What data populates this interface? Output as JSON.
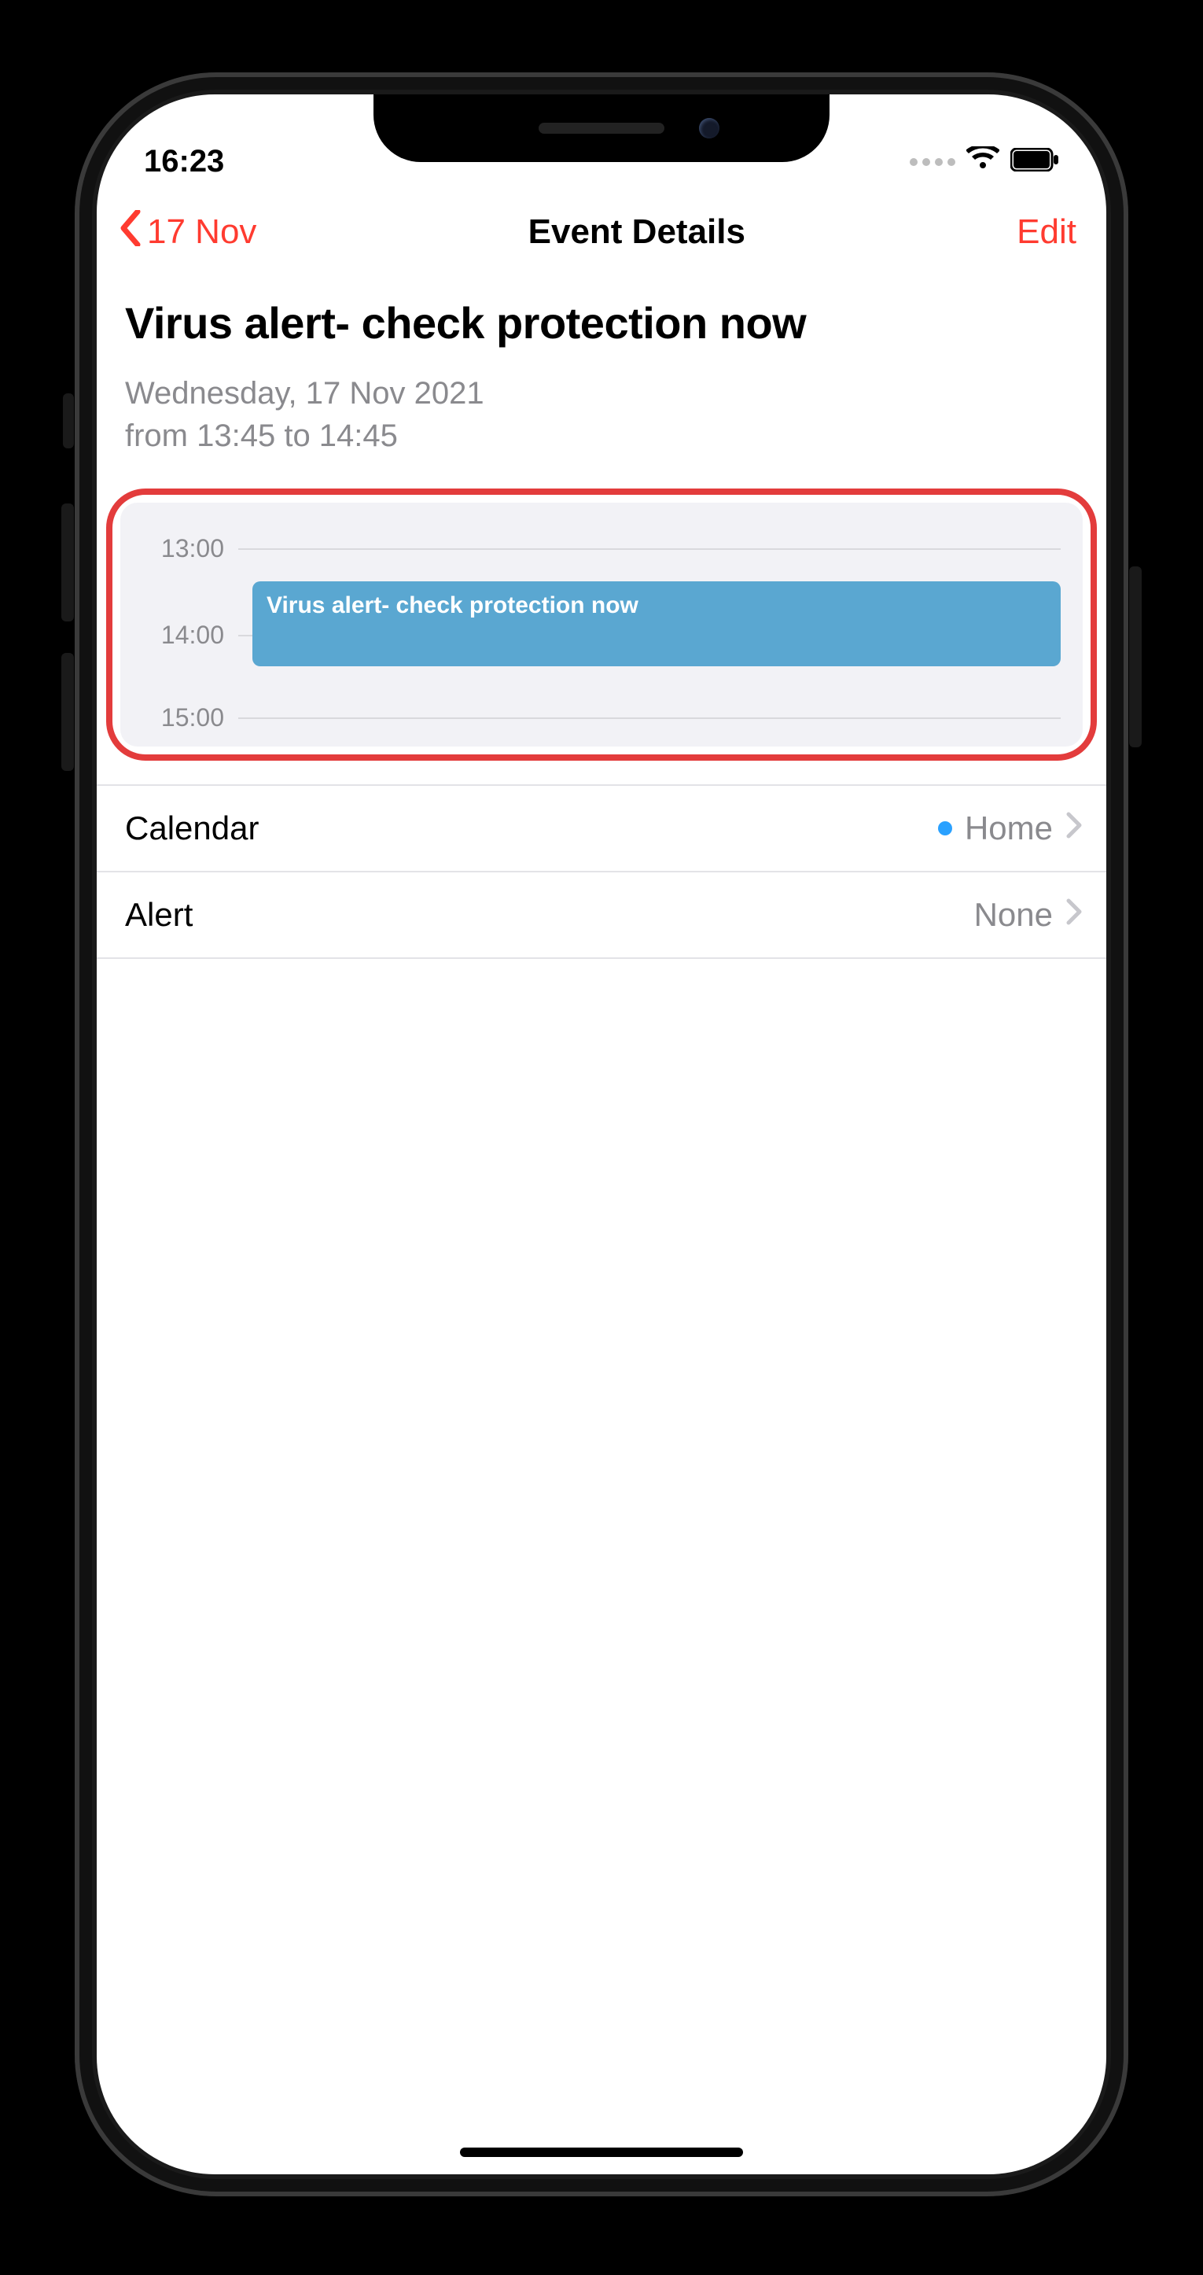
{
  "statusbar": {
    "time": "16:23"
  },
  "nav": {
    "back_label": "17 Nov",
    "title": "Event Details",
    "edit_label": "Edit"
  },
  "event": {
    "title": "Virus alert- check protection now",
    "date_line": "Wednesday, 17 Nov 2021",
    "time_line": "from 13:45 to 14:45"
  },
  "timeline": {
    "h1": "13:00",
    "h2": "14:00",
    "h3": "15:00",
    "block_label": "Virus alert- check protection now"
  },
  "rows": {
    "calendar_label": "Calendar",
    "calendar_value": "Home",
    "alert_label": "Alert",
    "alert_value": "None"
  }
}
